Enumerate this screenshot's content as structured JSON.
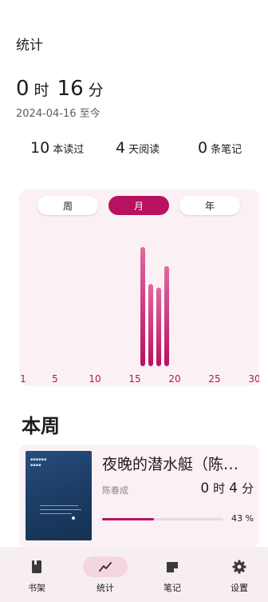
{
  "header": {
    "title": "统计"
  },
  "total_time": {
    "hours": "0",
    "hours_unit": "时",
    "minutes": "16",
    "minutes_unit": "分"
  },
  "since": "2024-04-16 至今",
  "stats": [
    {
      "num": "10",
      "label": "本读过"
    },
    {
      "num": "4",
      "label": "天阅读"
    },
    {
      "num": "0",
      "label": "条笔记"
    }
  ],
  "chart_tabs": {
    "week": "周",
    "month": "月",
    "year": "年",
    "selected": "month"
  },
  "colors": {
    "accent": "#b8115f",
    "card_bg": "#fbf1f5",
    "nav_bg": "#f7eef2",
    "nav_pill": "#f4d5e2"
  },
  "chart_data": {
    "type": "bar",
    "x_ticks": [
      "1",
      "5",
      "10",
      "15",
      "20",
      "25",
      "30"
    ],
    "xlim": [
      1,
      30
    ],
    "x": [
      16,
      17,
      18,
      19
    ],
    "values": [
      1.0,
      0.69,
      0.66,
      0.84
    ],
    "ylabel": "",
    "xlabel": "",
    "grid": false
  },
  "week_section": {
    "title": "本周"
  },
  "book": {
    "title": "夜晚的潜水艇（陈…",
    "author": "陈春成",
    "time_hours": "0",
    "time_hours_unit": "时",
    "time_minutes": "4",
    "time_minutes_unit": "分",
    "progress_percent": 43,
    "progress_label": "43 %"
  },
  "nav": [
    {
      "label": "书架",
      "icon": "book-icon",
      "active": false
    },
    {
      "label": "统计",
      "icon": "trending-icon",
      "active": true
    },
    {
      "label": "笔记",
      "icon": "note-icon",
      "active": false
    },
    {
      "label": "设置",
      "icon": "gear-icon",
      "active": false
    }
  ]
}
